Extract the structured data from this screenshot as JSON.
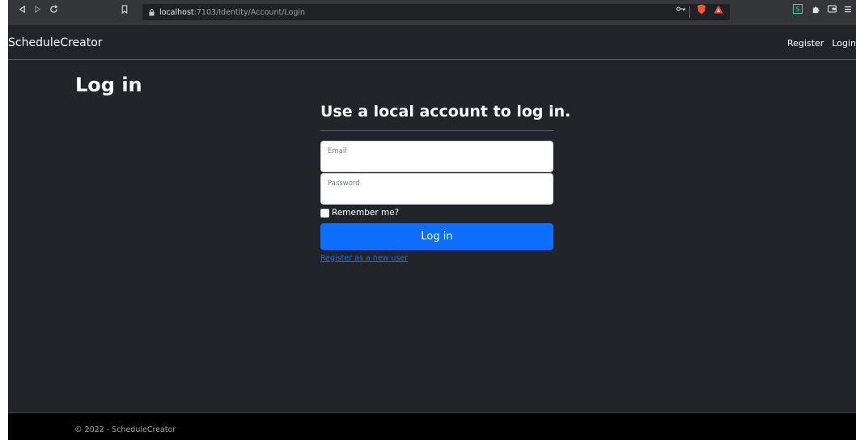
{
  "browser": {
    "url_host": "localhost",
    "url_path": ":7103/Identity/Account/Login",
    "icons": [
      "back-icon",
      "forward-icon",
      "reload-icon",
      "bookmark-icon",
      "lock-icon",
      "key-icon",
      "brave-shield-icon",
      "brave-rewards-icon",
      "sync-extension-icon",
      "puzzle-icon",
      "wallet-icon",
      "menu-icon"
    ],
    "extension_badge": "S"
  },
  "navbar": {
    "brand": "ScheduleCreator",
    "links": [
      {
        "label": "Register"
      },
      {
        "label": "Login"
      }
    ]
  },
  "main": {
    "page_title": "Log in",
    "section_title": "Use a local account to log in.",
    "email": {
      "placeholder": "Email",
      "value": ""
    },
    "password": {
      "placeholder": "Password",
      "value": ""
    },
    "remember_label": "Remember me?",
    "login_button": "Log in",
    "register_link": "Register as a new user"
  },
  "footer": {
    "text": "© 2022 - ScheduleCreator"
  },
  "colors": {
    "primary": "#0d6efd",
    "background": "#212529",
    "footer": "#000000"
  }
}
